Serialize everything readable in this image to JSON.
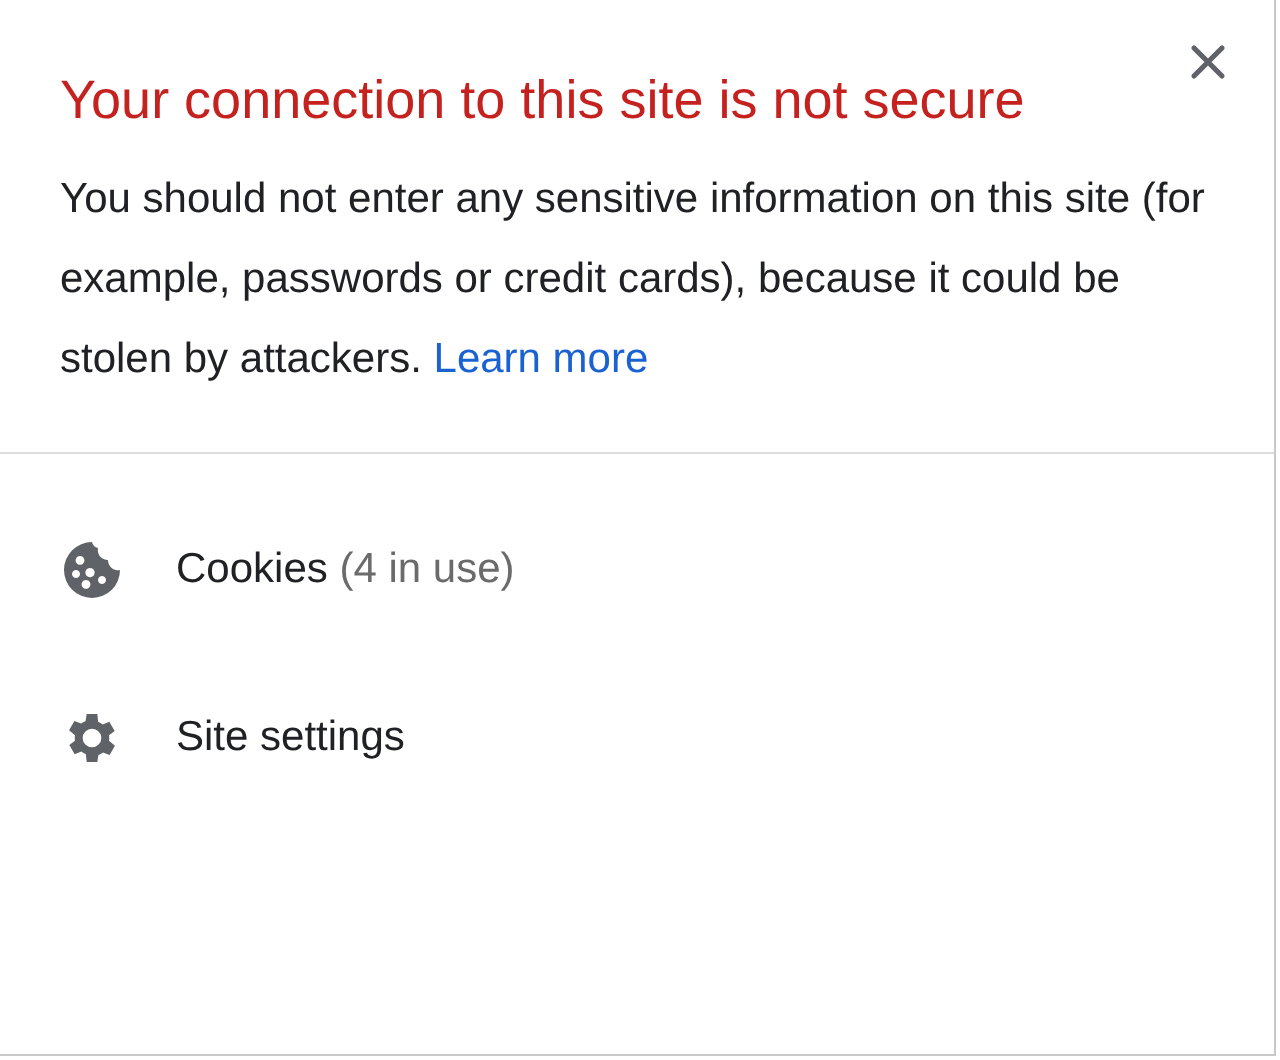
{
  "title": "Your connection to this site is not secure",
  "message": {
    "text": "You should not enter any sensitive information on this site (for example, passwords or credit cards), because it could be stolen by attackers.",
    "link": "Learn more"
  },
  "items": [
    {
      "kind": "cookies",
      "label": "Cookies",
      "detail": "(4 in use)"
    },
    {
      "kind": "settings",
      "label": "Site settings"
    }
  ]
}
